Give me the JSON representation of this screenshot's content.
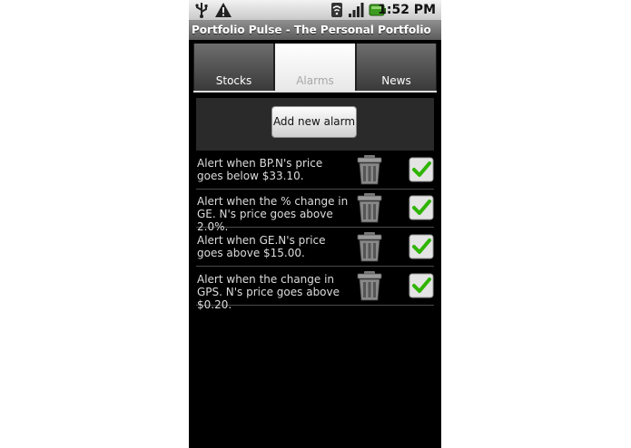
{
  "status_bar": {
    "time": "1:52 PM",
    "icons": [
      "usb-icon",
      "warning-icon",
      "wifi-icon",
      "signal-icon",
      "battery-icon"
    ]
  },
  "app": {
    "title": "Portfolio Pulse - The Personal Portfolio"
  },
  "tabs": [
    {
      "label": "Stocks",
      "active": false
    },
    {
      "label": "Alarms",
      "active": true
    },
    {
      "label": "News",
      "active": false
    }
  ],
  "toolbar": {
    "add_alarm_label": "Add new alarm"
  },
  "alarms": [
    {
      "text": "Alert when BP.N's price goes below $33.10.",
      "enabled": true
    },
    {
      "text": "Alert when the % change in GE. N's price goes above 2.0%.",
      "enabled": true
    },
    {
      "text": "Alert when GE.N's price goes above $15.00.",
      "enabled": true
    },
    {
      "text": "Alert when the change in GPS. N's price goes above $0.20.",
      "enabled": true
    }
  ],
  "colors": {
    "check_green": "#2fb400",
    "tab_active_text": "#a7a7a7"
  }
}
